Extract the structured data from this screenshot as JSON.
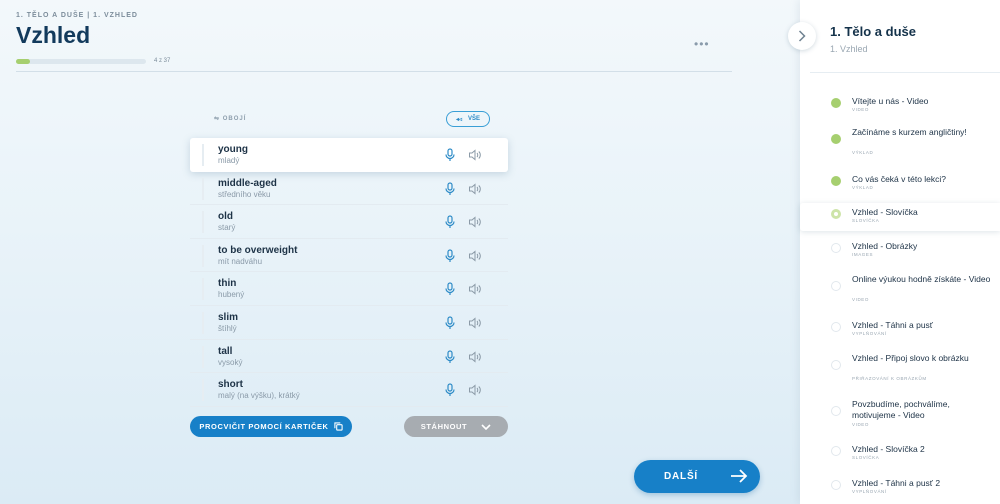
{
  "header": {
    "breadcrumb": "1. TĚLO A DUŠE | 1. VZHLED",
    "title": "Vzhled",
    "progress_text": "4 z 37",
    "progress_fraction": 0.108,
    "more_label": "•••"
  },
  "list": {
    "both_label": "OBOJÍ",
    "all_label": "VŠE",
    "words": [
      {
        "en": "young",
        "cz": "mladý"
      },
      {
        "en": "middle-aged",
        "cz": "středního věku"
      },
      {
        "en": "old",
        "cz": "starý"
      },
      {
        "en": "to be overweight",
        "cz": "mít nadváhu"
      },
      {
        "en": "thin",
        "cz": "hubený"
      },
      {
        "en": "slim",
        "cz": "štíhlý"
      },
      {
        "en": "tall",
        "cz": "vysoký"
      },
      {
        "en": "short",
        "cz": "malý (na výšku), krátký"
      }
    ],
    "active_index": 0
  },
  "buttons": {
    "practice": "PROCVIČIT POMOCÍ KARTIČEK",
    "download": "STÁHNOUT",
    "next": "DALŠÍ"
  },
  "sidebar": {
    "title": "1. Tělo a duše",
    "subtitle": "1. Vzhled",
    "items": [
      {
        "name": "Vítejte u nás - Video",
        "type": "VIDEO",
        "status": "done"
      },
      {
        "name": "Začínáme s kurzem angličtiny!",
        "type": "VÝKLAD",
        "status": "done"
      },
      {
        "name": "Co vás čeká v této lekci?",
        "type": "VÝKLAD",
        "status": "done"
      },
      {
        "name": "Vzhled - Slovíčka",
        "type": "SLOVÍČKA",
        "status": "current"
      },
      {
        "name": "Vzhled - Obrázky",
        "type": "IMAGES",
        "status": "todo"
      },
      {
        "name": "Online výukou hodně získáte - Video",
        "type": "VIDEO",
        "status": "todo"
      },
      {
        "name": "Vzhled - Táhni a pusť",
        "type": "VYPLŇOVÁNÍ",
        "status": "todo"
      },
      {
        "name": "Vzhled - Připoj slovo k obrázku",
        "type": "PŘIŘAZOVÁNÍ K OBRÁZKŮM",
        "status": "todo"
      },
      {
        "name": "Povzbudíme, pochválíme, motivujeme - Video",
        "type": "VIDEO",
        "status": "todo"
      },
      {
        "name": "Vzhled - Slovíčka 2",
        "type": "SLOVÍČKA",
        "status": "todo"
      },
      {
        "name": "Vzhled - Táhni a pusť 2",
        "type": "VYPLŇOVÁNÍ",
        "status": "todo"
      }
    ]
  },
  "colors": {
    "accent": "#1780c8",
    "done": "#a6cf6f",
    "title": "#123a5c"
  }
}
